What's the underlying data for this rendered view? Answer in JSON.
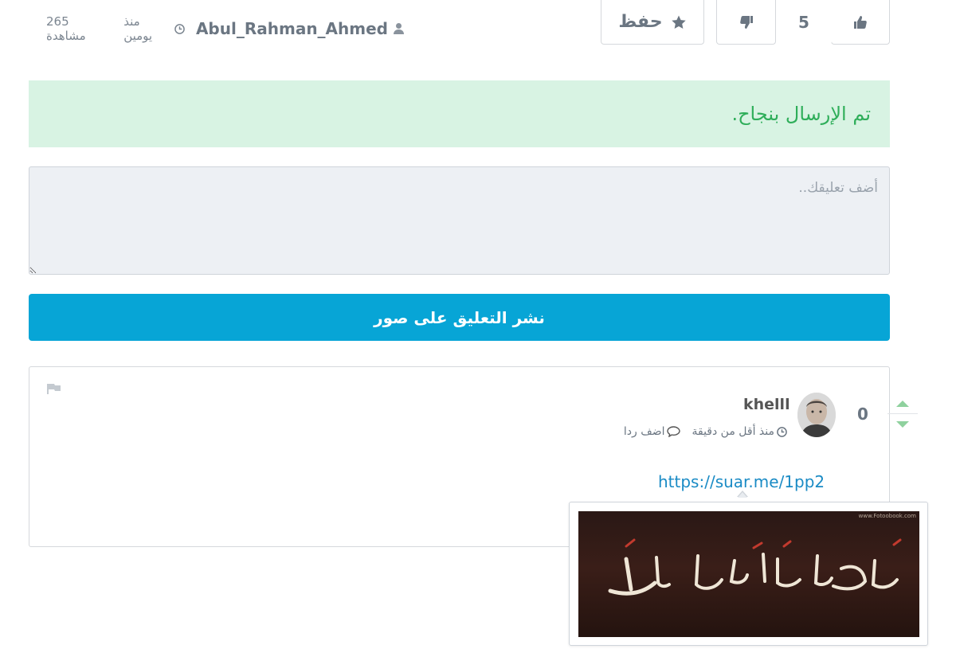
{
  "post_actions": {
    "like_icon": "thumbs-up-icon",
    "vote_count": "5",
    "dislike_icon": "thumbs-down-icon",
    "save_icon": "star-icon",
    "save_label": "حفظ"
  },
  "post_meta": {
    "author": "Abul_Rahman_Ahmed",
    "time": "منذ يومين",
    "views": "265 مشاهدة"
  },
  "alert": {
    "message": "تم الإرسال بنجاح.",
    "bg_color": "#d8f3e3",
    "text_color": "#2fae5a"
  },
  "comment_form": {
    "placeholder": "أضف تعليقك..",
    "submit_label": "نشر التعليق على صور",
    "submit_color": "#07a5d6"
  },
  "comment": {
    "votes": "0",
    "author": "khelll",
    "time": "منذ أقل من دقيقة",
    "reply_label": "اضف ردا",
    "link": "https://suar.me/1pp2",
    "link_color": "#1a8bc5",
    "upvote_color": "#8fd19e",
    "preview_watermark": "www.Fotoobook.com"
  }
}
